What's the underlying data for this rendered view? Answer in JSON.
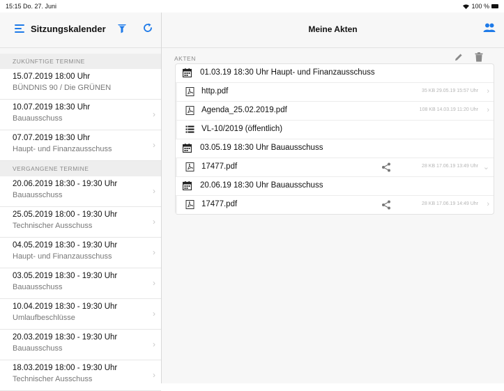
{
  "status_bar": {
    "time": "15:15  Do. 27. Juni",
    "battery": "100 %"
  },
  "left": {
    "title": "Sitzungskalender",
    "icons": [
      "menu-icon",
      "filter-icon",
      "refresh-icon"
    ],
    "sections": [
      {
        "header": "ZUKÜNFTIGE TERMINE",
        "items": [
          {
            "line1": "15.07.2019 18:00 Uhr",
            "line2": "BÜNDNIS 90 / Die GRÜNEN"
          },
          {
            "line1": "10.07.2019 18:30 Uhr",
            "line2": "Bauausschuss"
          },
          {
            "line1": "07.07.2019 18:30 Uhr",
            "line2": "Haupt- und Finanzausschuss"
          }
        ]
      },
      {
        "header": "VERGANGENE TERMINE",
        "items": [
          {
            "line1": "20.06.2019 18:30 -  19:30 Uhr",
            "line2": "Bauausschuss"
          },
          {
            "line1": "25.05.2019 18:00 -  19:30 Uhr",
            "line2": "Technischer Ausschuss"
          },
          {
            "line1": "04.05.2019 18:30 -  19:30 Uhr",
            "line2": "Haupt- und Finanzausschuss"
          },
          {
            "line1": "03.05.2019 18:30 -  19:30 Uhr",
            "line2": "Bauausschuss"
          },
          {
            "line1": "10.04.2019 18:30 -  19:30 Uhr",
            "line2": "Umlaufbeschlüsse"
          },
          {
            "line1": "20.03.2019 18:30 -  19:30 Uhr",
            "line2": "Bauausschuss"
          },
          {
            "line1": "18.03.2019 18:00 -  19:30 Uhr",
            "line2": "Technischer Ausschuss"
          }
        ]
      }
    ]
  },
  "right": {
    "title": "Meine Akten",
    "section_label": "AKTEN",
    "rows": [
      {
        "kind": "date",
        "icon": "calendar-icon",
        "text": "01.03.19 18:30 Uhr  Haupt- und Finanzausschuss"
      },
      {
        "kind": "doc",
        "icon": "pdf-icon",
        "text": "http.pdf",
        "meta": "35 KB  29.05.19 15:57 Uhr",
        "shared": false
      },
      {
        "kind": "doc",
        "icon": "pdf-icon",
        "text": "Agenda_25.02.2019.pdf",
        "meta": "108 KB  14.03.19 11:20 Uhr",
        "shared": false
      },
      {
        "kind": "doc",
        "icon": "list-icon",
        "text": "VL-10/2019 (öffentlich)",
        "meta": "",
        "shared": false
      },
      {
        "kind": "date",
        "icon": "calendar-icon",
        "text": "03.05.19 18:30 Uhr  Bauausschuss"
      },
      {
        "kind": "doc",
        "icon": "pdf-icon",
        "text": "17477.pdf",
        "meta": "28 KB  17.06.19 13:49 Uhr",
        "shared": true
      },
      {
        "kind": "date",
        "icon": "calendar-icon",
        "text": "20.06.19 18:30 Uhr  Bauausschuss"
      },
      {
        "kind": "doc",
        "icon": "pdf-icon",
        "text": "17477.pdf",
        "meta": "28 KB  17.06.19 14:49 Uhr",
        "shared": true
      }
    ]
  },
  "colors": {
    "accent": "#1e7ae8",
    "divider": "#e6e6e6",
    "secondary_text": "#777777"
  }
}
